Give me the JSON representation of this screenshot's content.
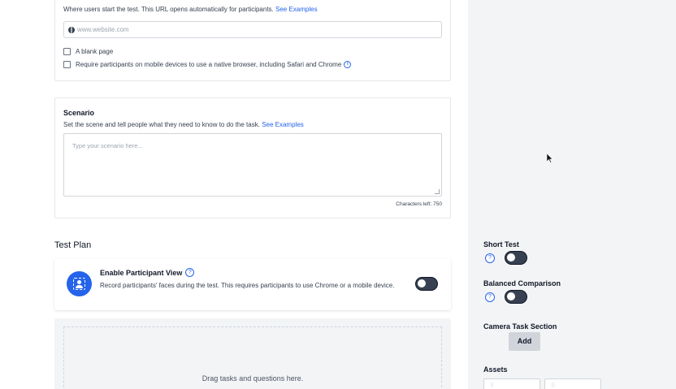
{
  "url_section": {
    "description": "Where users start the test. This URL opens automatically for participants.",
    "examples_link": "See Examples",
    "url_placeholder": "www.website.com",
    "blank_page_label": "A blank page",
    "native_browser_label": "Require participants on mobile devices to use a native browser, including Safari and Chrome"
  },
  "scenario": {
    "title": "Scenario",
    "description": "Set the scene and tell people what they need to know to do the task.",
    "examples_link": "See Examples",
    "placeholder": "Type your scenario here...",
    "chars_left": "Characters left: 750"
  },
  "test_plan": {
    "title": "Test Plan",
    "participant_view": {
      "title": "Enable Participant View",
      "description": "Record participants' faces during the test. This requires participants to use Chrome or a mobile device."
    },
    "drop_zone_text": "Drag tasks and questions here."
  },
  "sidebar": {
    "short_test": "Short Test",
    "balanced_comparison": "Balanced Comparison",
    "camera_task_section": "Camera Task Section",
    "add_button": "Add",
    "assets": "Assets"
  },
  "icons": {
    "help": "?",
    "info": "i",
    "grip": "⠿"
  },
  "colors": {
    "accent": "#2563eb",
    "toggle_off": "#374151",
    "sidebar_bg": "#f3f4f6"
  }
}
